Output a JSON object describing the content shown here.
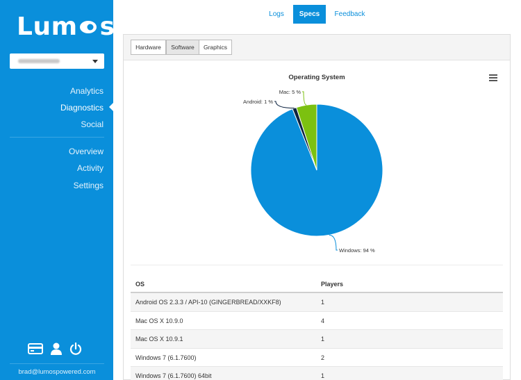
{
  "app": {
    "name": "Lumos",
    "user_email": "brad@lumospowered.com"
  },
  "sidebar": {
    "game_selector": {
      "value": ""
    },
    "primary_nav": [
      {
        "label": "Analytics",
        "active": false
      },
      {
        "label": "Diagnostics",
        "active": true
      },
      {
        "label": "Social",
        "active": false
      }
    ],
    "secondary_nav": [
      {
        "label": "Overview"
      },
      {
        "label": "Activity"
      },
      {
        "label": "Settings"
      }
    ],
    "footer_icons": [
      "credit-card-icon",
      "user-icon",
      "power-icon"
    ]
  },
  "top_tabs": [
    {
      "label": "Logs",
      "active": false
    },
    {
      "label": "Specs",
      "active": true
    },
    {
      "label": "Feedback",
      "active": false
    }
  ],
  "sub_tabs": [
    {
      "label": "Hardware",
      "active": false
    },
    {
      "label": "Software",
      "active": true
    },
    {
      "label": "Graphics",
      "active": false
    }
  ],
  "chart_data": {
    "type": "pie",
    "title": "Operating System",
    "slices": [
      {
        "label": "Windows",
        "value": 94,
        "display": "Windows: 94 %",
        "color": "#0a8fdb"
      },
      {
        "label": "Android",
        "value": 1,
        "display": "Android: 1 %",
        "color": "#0c2340"
      },
      {
        "label": "Mac",
        "value": 5,
        "display": "Mac: 5 %",
        "color": "#7cc110"
      }
    ]
  },
  "table": {
    "headers": [
      "OS",
      "Players"
    ],
    "rows": [
      [
        "Android OS 2.3.3 / API-10 (GINGERBREAD/XXKF8)",
        "1"
      ],
      [
        "Mac OS X 10.9.0",
        "4"
      ],
      [
        "Mac OS X 10.9.1",
        "1"
      ],
      [
        "Windows 7 (6.1.7600)",
        "2"
      ],
      [
        "Windows 7 (6.1.7600) 64bit",
        "1"
      ]
    ]
  }
}
